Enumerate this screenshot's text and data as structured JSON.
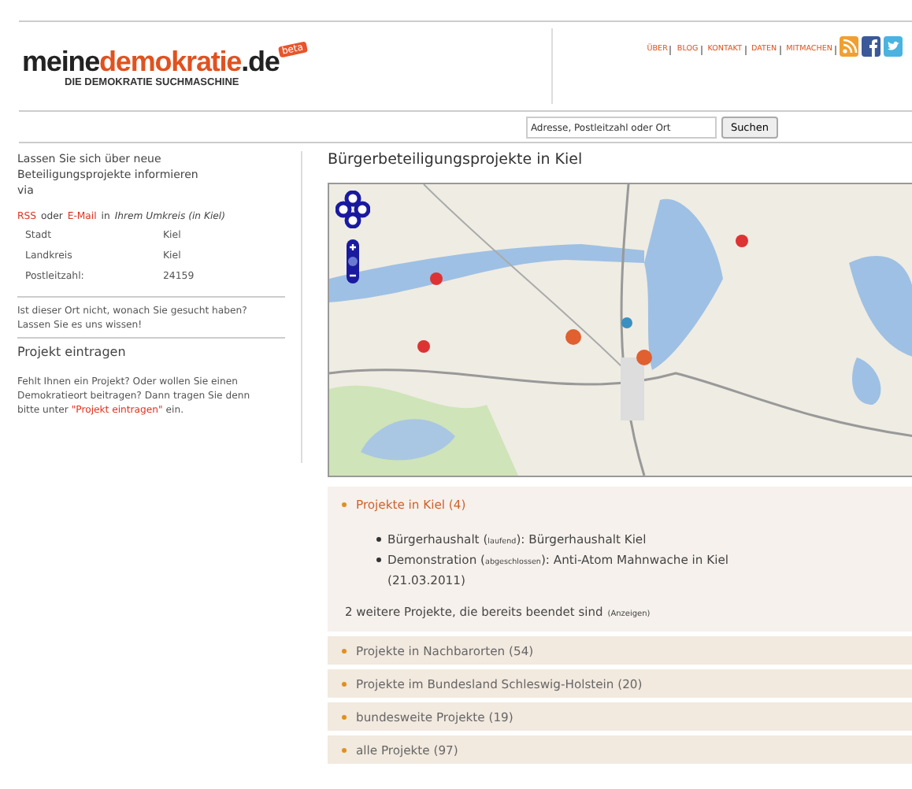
{
  "header": {
    "logo": {
      "parts": [
        {
          "text": "meine",
          "highlight": false
        },
        {
          "text": "demokratie",
          "highlight": true
        },
        {
          "text": ".de",
          "highlight": false
        }
      ],
      "badge": "beta",
      "tagline": "DIE DEMOKRATIE SUCHMASCHINE"
    },
    "nav": [
      "ÜBER",
      "BLOG",
      "KONTAKT",
      "DATEN",
      "MITMACHEN"
    ]
  },
  "search": {
    "placeholder": "Adresse, Postleitzahl oder Ort",
    "button": "Suchen"
  },
  "sidebar": {
    "intro": "Lassen Sie sich über neue Beteiligungsprojekte informieren via",
    "subscribe": [
      {
        "text": "RSS",
        "kind": "link"
      },
      {
        "text": "oder",
        "kind": "plain"
      },
      {
        "text": "E-Mail",
        "kind": "link"
      },
      {
        "text": "in",
        "kind": "plain"
      },
      {
        "text": "Ihrem Umkreis (in Kiel)",
        "kind": "italic"
      }
    ],
    "location": [
      {
        "label": "Stadt",
        "value": "Kiel"
      },
      {
        "label": "Landkreis",
        "value": "Kiel"
      },
      {
        "label": "Postleitzahl:",
        "value": "24159"
      }
    ],
    "notice": "Ist dieser Ort nicht, wonach Sie gesucht haben? Lassen Sie es uns wissen!",
    "heading": "Projekt eintragen",
    "paragraph": "Fehlt Ihnen ein Projekt? Oder wollen Sie einen Demokratieort beitragen? Dann tragen Sie denn bitte unter",
    "link": "\"Projekt eintragen\"",
    "after": "ein."
  },
  "main": {
    "title": "Bürgerbeteiligungsprojekte in Kiel",
    "sections": [
      {
        "title": "Projekte in Kiel (4)",
        "expanded": true,
        "items": [
          {
            "before": "Bürgerhaushalt (",
            "status": "laufend",
            "after": "): Bürgerhaushalt Kiel"
          },
          {
            "before": "Demonstration (",
            "status": "abgeschlossen",
            "after": "): Anti-Atom Mahnwache in Kiel (21.03.2011)"
          }
        ],
        "more": {
          "text": "2 weitere Projekte, die bereits beendet sind",
          "link": "(Anzeigen)"
        }
      },
      {
        "title": "Projekte in Nachbarorten (54)",
        "expanded": false
      },
      {
        "title": "Projekte im Bundesland Schleswig-Holstein (20)",
        "expanded": false
      },
      {
        "title": "bundesweite Projekte (19)",
        "expanded": false
      },
      {
        "title": "alle Projekte (97)",
        "expanded": false
      }
    ]
  }
}
